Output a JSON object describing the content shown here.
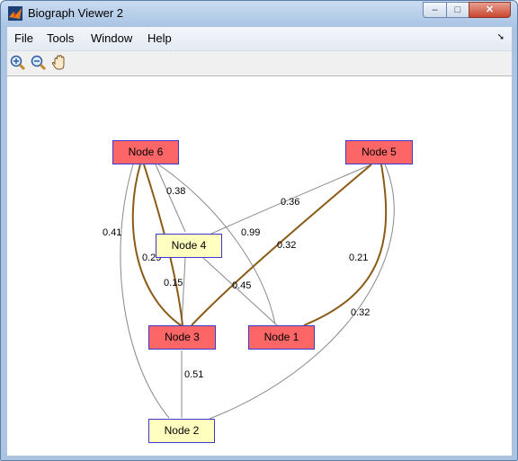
{
  "window": {
    "title": "Biograph Viewer 2",
    "controls": {
      "minimize": "–",
      "maximize": "□",
      "close": "✕"
    }
  },
  "menu": {
    "items": [
      "File",
      "Tools",
      "Window",
      "Help"
    ],
    "dock_icon": "dock-arrow-icon"
  },
  "toolbar": {
    "tools": [
      "zoom-in-icon",
      "zoom-out-icon",
      "pan-hand-icon"
    ]
  },
  "graph": {
    "nodes": [
      {
        "id": "node6",
        "label": "Node 6",
        "color": "#fc6666"
      },
      {
        "id": "node5",
        "label": "Node 5",
        "color": "#fc6666"
      },
      {
        "id": "node4",
        "label": "Node 4",
        "color": "#ffffc0"
      },
      {
        "id": "node3",
        "label": "Node 3",
        "color": "#fc6666"
      },
      {
        "id": "node1",
        "label": "Node 1",
        "color": "#fc6666"
      },
      {
        "id": "node2",
        "label": "Node 2",
        "color": "#ffffc0"
      }
    ],
    "edges": [
      {
        "from": "Node 6",
        "to": "Node 4",
        "weight": "0.38"
      },
      {
        "from": "Node 6",
        "to": "Node 1",
        "weight": "0.99"
      },
      {
        "from": "Node 6",
        "to": "Node 2",
        "weight": "0.41"
      },
      {
        "from": "Node 6",
        "to": "Node 3",
        "weight": "0.29"
      },
      {
        "from": "Node 5",
        "to": "Node 4",
        "weight": "0.36"
      },
      {
        "from": "Node 5",
        "to": "Node 3",
        "weight": "0.32"
      },
      {
        "from": "Node 5",
        "to": "Node 1",
        "weight": "0.21"
      },
      {
        "from": "Node 5",
        "to": "Node 2",
        "weight": "0.32"
      },
      {
        "from": "Node 4",
        "to": "Node 3",
        "weight": "0.15"
      },
      {
        "from": "Node 4",
        "to": "Node 1",
        "weight": "0.45"
      },
      {
        "from": "Node 3",
        "to": "Node 2",
        "weight": "0.51"
      }
    ],
    "colors": {
      "path_edge": "#8b5a16",
      "edge": "#888888",
      "node_border": "#3a3ad0"
    }
  }
}
